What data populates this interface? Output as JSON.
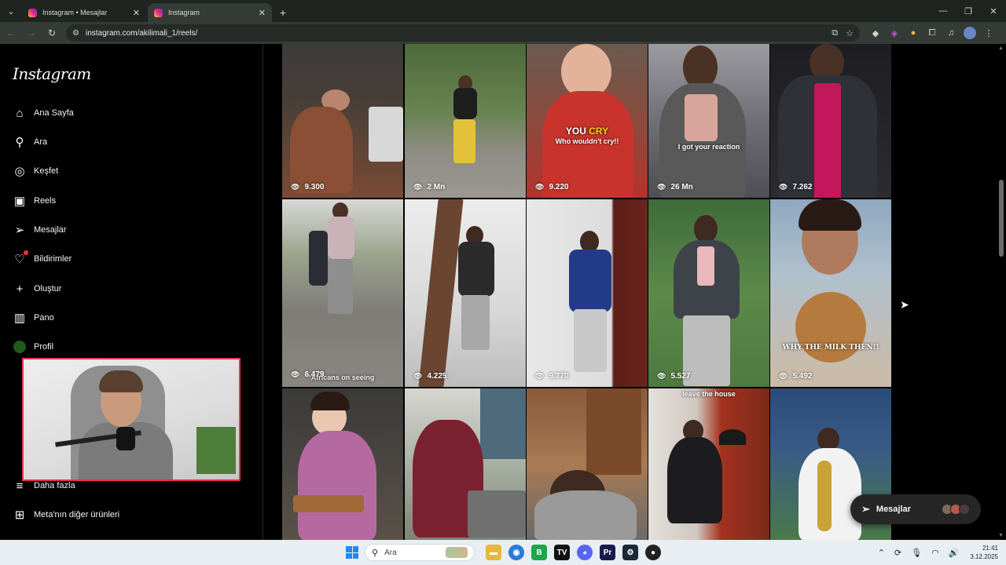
{
  "browser": {
    "tabs": [
      {
        "title": "Instagram • Mesajlar",
        "active": false
      },
      {
        "title": "Instagram",
        "active": true
      }
    ],
    "url": "instagram.com/akilimali_1/reels/"
  },
  "sidebar": {
    "logo": "Instagram",
    "items": [
      {
        "label": "Ana Sayfa",
        "icon": "home-icon"
      },
      {
        "label": "Ara",
        "icon": "search-icon"
      },
      {
        "label": "Keşfet",
        "icon": "compass-icon"
      },
      {
        "label": "Reels",
        "icon": "reels-icon"
      },
      {
        "label": "Mesajlar",
        "icon": "messages-icon"
      },
      {
        "label": "Bildirimler",
        "icon": "heart-icon"
      },
      {
        "label": "Oluştur",
        "icon": "plus-icon"
      },
      {
        "label": "Pano",
        "icon": "dashboard-icon"
      },
      {
        "label": "Profil",
        "icon": "avatar"
      },
      {
        "label": "Daha fazla",
        "icon": "menu-icon"
      },
      {
        "label": "Meta'nın diğer ürünleri",
        "icon": "meta-apps-icon"
      }
    ]
  },
  "reels": [
    {
      "views": "9.300"
    },
    {
      "views": "2 Mn"
    },
    {
      "views": "9.220",
      "caption_yellow": "CRY",
      "caption_white": "YOU",
      "caption_sub": "Who wouldn't cry!!"
    },
    {
      "views": "26 Mn",
      "caption_sub": "I got your reaction"
    },
    {
      "views": "7.262"
    },
    {
      "views": "6.479",
      "caption_sub": "Africans on seeing"
    },
    {
      "views": "4.225"
    },
    {
      "views": "9.770"
    },
    {
      "views": "5.527"
    },
    {
      "views": "5.492",
      "caption_sub": "WHY THE MILK THEN!!"
    },
    {
      "views": ""
    },
    {
      "views": ""
    },
    {
      "views": ""
    },
    {
      "views": "",
      "caption_sub": "leave the house"
    },
    {
      "views": ""
    }
  ],
  "messages_pill": {
    "label": "Mesajlar"
  },
  "taskbar": {
    "search_placeholder": "Ara",
    "time": "21:41",
    "date": "3.12.2025"
  },
  "colors": {
    "instagram_gradient": [
      "#f9ce34",
      "#ee2a7b",
      "#6228d7"
    ],
    "webcam_border": "#e8354a",
    "notification": "#ff3040"
  }
}
